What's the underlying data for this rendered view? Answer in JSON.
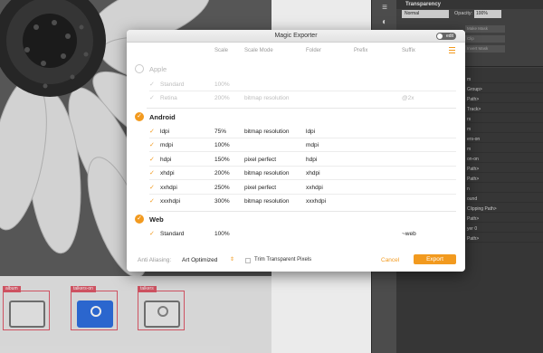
{
  "dialog": {
    "title": "Magic Exporter",
    "toggle_label": "edit",
    "columns": [
      "Scale",
      "Scale Mode",
      "Folder",
      "Prefix",
      "Suffix"
    ],
    "sections": [
      {
        "name": "Apple",
        "enabled": false,
        "rows": [
          {
            "name": "Standard",
            "scale": "100%",
            "mode": "",
            "folder": "",
            "prefix": "",
            "suffix": ""
          },
          {
            "name": "Retina",
            "scale": "200%",
            "mode": "bitmap resolution",
            "folder": "",
            "prefix": "",
            "suffix": "@2x"
          }
        ]
      },
      {
        "name": "Android",
        "enabled": true,
        "rows": [
          {
            "name": "ldpi",
            "scale": "75%",
            "mode": "bitmap resolution",
            "folder": "ldpi",
            "prefix": "",
            "suffix": ""
          },
          {
            "name": "mdpi",
            "scale": "100%",
            "mode": "",
            "folder": "mdpi",
            "prefix": "",
            "suffix": ""
          },
          {
            "name": "hdpi",
            "scale": "150%",
            "mode": "pixel perfect",
            "folder": "hdpi",
            "prefix": "",
            "suffix": ""
          },
          {
            "name": "xhdpi",
            "scale": "200%",
            "mode": "bitmap resolution",
            "folder": "xhdpi",
            "prefix": "",
            "suffix": ""
          },
          {
            "name": "xxhdpi",
            "scale": "250%",
            "mode": "pixel perfect",
            "folder": "xxhdpi",
            "prefix": "",
            "suffix": ""
          },
          {
            "name": "xxxhdpi",
            "scale": "300%",
            "mode": "bitmap resolution",
            "folder": "xxxhdpi",
            "prefix": "",
            "suffix": ""
          }
        ]
      },
      {
        "name": "Web",
        "enabled": true,
        "rows": [
          {
            "name": "Standard",
            "scale": "100%",
            "mode": "",
            "folder": "",
            "prefix": "",
            "suffix": "~web"
          }
        ]
      }
    ],
    "footer": {
      "antialias_label": "Anti Aliasing:",
      "antialias_value": "Art Optimized",
      "trim_label": "Trim Transparent Pixels",
      "trim_checked": false,
      "cancel_label": "Cancel",
      "export_label": "Export"
    },
    "accent_color": "#f29a1f"
  },
  "panel": {
    "title": "Transparency",
    "blend_mode": "Normal",
    "opacity_label": "Opacity:",
    "opacity_value": "100%",
    "make_mask_label": "Make Mask",
    "clip_label": "Clip",
    "invert_mask_label": "Invert Mask",
    "layers": [
      "m",
      "Group>",
      "Path>",
      "Track>",
      "rs",
      "m",
      "ers-on",
      "m",
      "on-on",
      "Path>",
      "Path>",
      "n",
      "ound",
      "Clipping Path>",
      "Path>",
      "yer 0",
      "Path>"
    ]
  },
  "artboard": {
    "symbols": [
      {
        "tag": "album"
      },
      {
        "tag": "talkers-on"
      },
      {
        "tag": "talkers"
      }
    ]
  },
  "toolstrip": {
    "icons": [
      "menu-icon",
      "transparency-panel-icon",
      "layers-icon"
    ]
  }
}
